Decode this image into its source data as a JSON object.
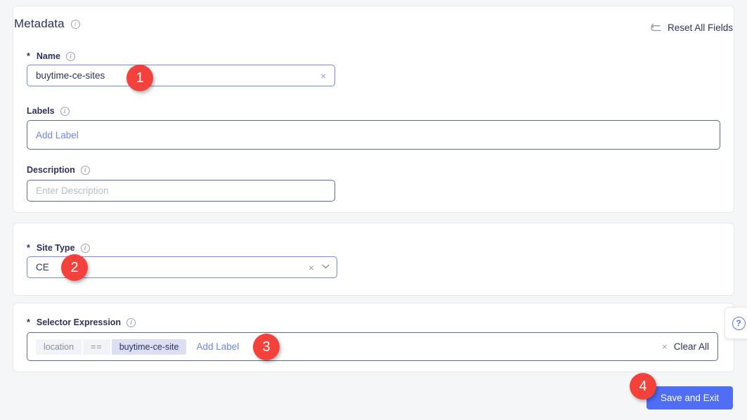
{
  "metadata_card": {
    "title": "Metadata",
    "title_info_icon": "info-icon",
    "reset_all": {
      "label": "Reset All Fields",
      "icon": "reset-arrow-icon"
    },
    "fields": {
      "name": {
        "label": "Name",
        "required_marker": "*",
        "info_icon": "info-icon",
        "value": "buytime-ce-sites",
        "clear_icon": "×"
      },
      "labels": {
        "label": "Labels",
        "info_icon": "info-icon",
        "add_label_link": "Add Label"
      },
      "description": {
        "label": "Description",
        "info_icon": "info-icon",
        "value": "",
        "placeholder": "Enter Description"
      }
    }
  },
  "sitetype_card": {
    "label": "Site Type",
    "required_marker": "*",
    "info_icon": "info-icon",
    "value": "CE",
    "clear_icon": "×",
    "chevron_icon": "˅"
  },
  "selector_card": {
    "label": "Selector Expression",
    "required_marker": "*",
    "info_icon": "info-icon",
    "expression": {
      "key": "location",
      "operator": "==",
      "value": "buytime-ce-site"
    },
    "add_label_link": "Add Label",
    "clear_all": {
      "label": "Clear All",
      "icon": "×"
    }
  },
  "footer": {
    "save_button": "Save and Exit"
  },
  "help": {
    "icon": "question-mark-icon",
    "glyph": "?"
  },
  "annotations": [
    {
      "number": "1"
    },
    {
      "number": "2"
    },
    {
      "number": "3"
    },
    {
      "number": "4"
    }
  ],
  "colors": {
    "accent_blue": "#4f6df5",
    "link_blue": "#6f86e8",
    "badge_red": "#f4413c",
    "text_navy": "#2c3359",
    "page_bg": "#f5f6f8",
    "chip_value_bg": "#dcdff4"
  }
}
